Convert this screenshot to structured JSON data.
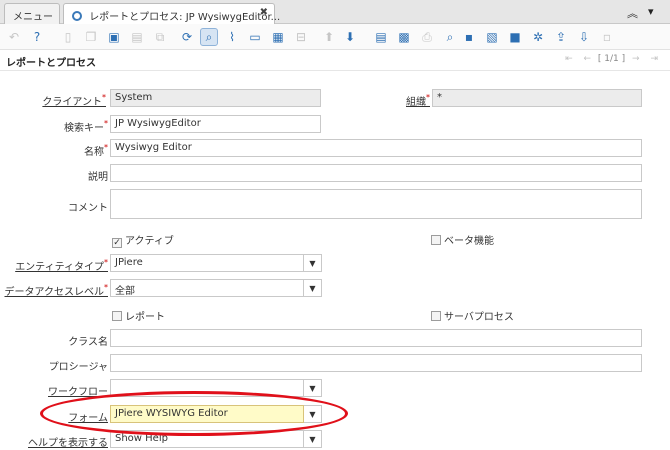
{
  "tabs": {
    "menu": "メニュー",
    "active": "レポートとプロセス: JP WysiwygEditor..."
  },
  "window_title": "レポートとプロセス",
  "pager": "[ 1/1 ]",
  "fields": {
    "client_label": "クライアント",
    "client_value": "System",
    "org_label": "組織",
    "org_value": "*",
    "search_key_label": "検索キー",
    "search_key_value": "JP WysiwygEditor",
    "name_label": "名称",
    "name_value": "Wysiwyg Editor",
    "description_label": "説明",
    "description_value": "",
    "comment_label": "コメント",
    "active_label": "アクティブ",
    "beta_label": "ベータ機能",
    "entity_type_label": "エンティティタイプ",
    "entity_type_value": "JPiere",
    "data_access_label": "データアクセスレベル",
    "data_access_value": "全部",
    "report_label": "レポート",
    "server_process_label": "サーバプロセス",
    "class_name_label": "クラス名",
    "class_name_value": "",
    "procedure_label": "プロシージャ",
    "procedure_value": "",
    "workflow_label": "ワークフロー",
    "workflow_value": "",
    "form_label": "フォーム",
    "form_value": "JPiere WYSIWYG Editor",
    "show_help_label": "ヘルプを表示する",
    "show_help_value": "Show Help"
  },
  "accent_color": "#e0101a"
}
